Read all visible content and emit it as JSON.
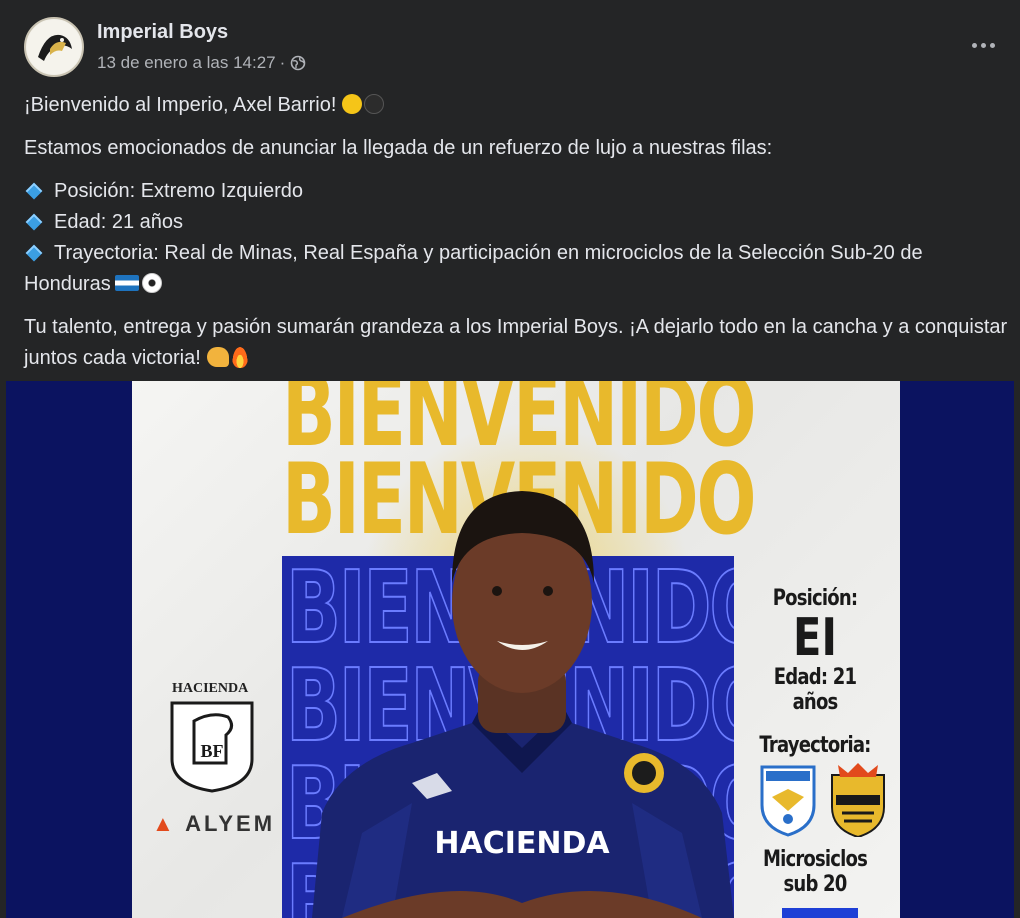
{
  "post": {
    "page_name": "Imperial Boys",
    "timestamp": "13 de enero a las 14:27",
    "separator": "·",
    "audience_icon": "globe-icon",
    "more_icon": "more-horizontal-icon"
  },
  "body": {
    "greeting": "¡Bienvenido al Imperio, Axel Barrio!",
    "intro": "Estamos emocionados de anunciar la llegada de un refuerzo de lujo a nuestras filas:",
    "bullets": [
      "Posición: Extremo Izquierdo",
      "Edad: 21 años",
      "Trayectoria: Real de Minas, Real España y participación en microciclos de la Selección Sub-20 de"
    ],
    "bullet_continuation": "Honduras",
    "closing": "Tu talento, entrega y pasión sumarán grandeza a los Imperial Boys. ¡A dejarlo todo en la cancha y a conquistar juntos cada victoria!",
    "emojis": {
      "greeting": [
        "yellow-circle",
        "black-circle"
      ],
      "honduras": [
        "honduras-flag",
        "soccer-ball"
      ],
      "closing": [
        "flexed-biceps",
        "fire"
      ]
    }
  },
  "poster": {
    "headline": "BIENVENIDO",
    "sponsor_top": "HACIENDA",
    "sponsor_monogram": "BF",
    "sponsor_bottom": "ALYEM",
    "position_label": "Posición:",
    "position_value": "EI",
    "age": "Edad: 21 años",
    "career_label": "Trayectoria:",
    "career_note_1": "Microsiclos",
    "career_note_2": "sub 20",
    "shirt_text": "HACIENDA",
    "colors": {
      "navy": "#0b1360",
      "royal_blue": "#1e2aa8",
      "gold": "#e8b92c"
    }
  }
}
